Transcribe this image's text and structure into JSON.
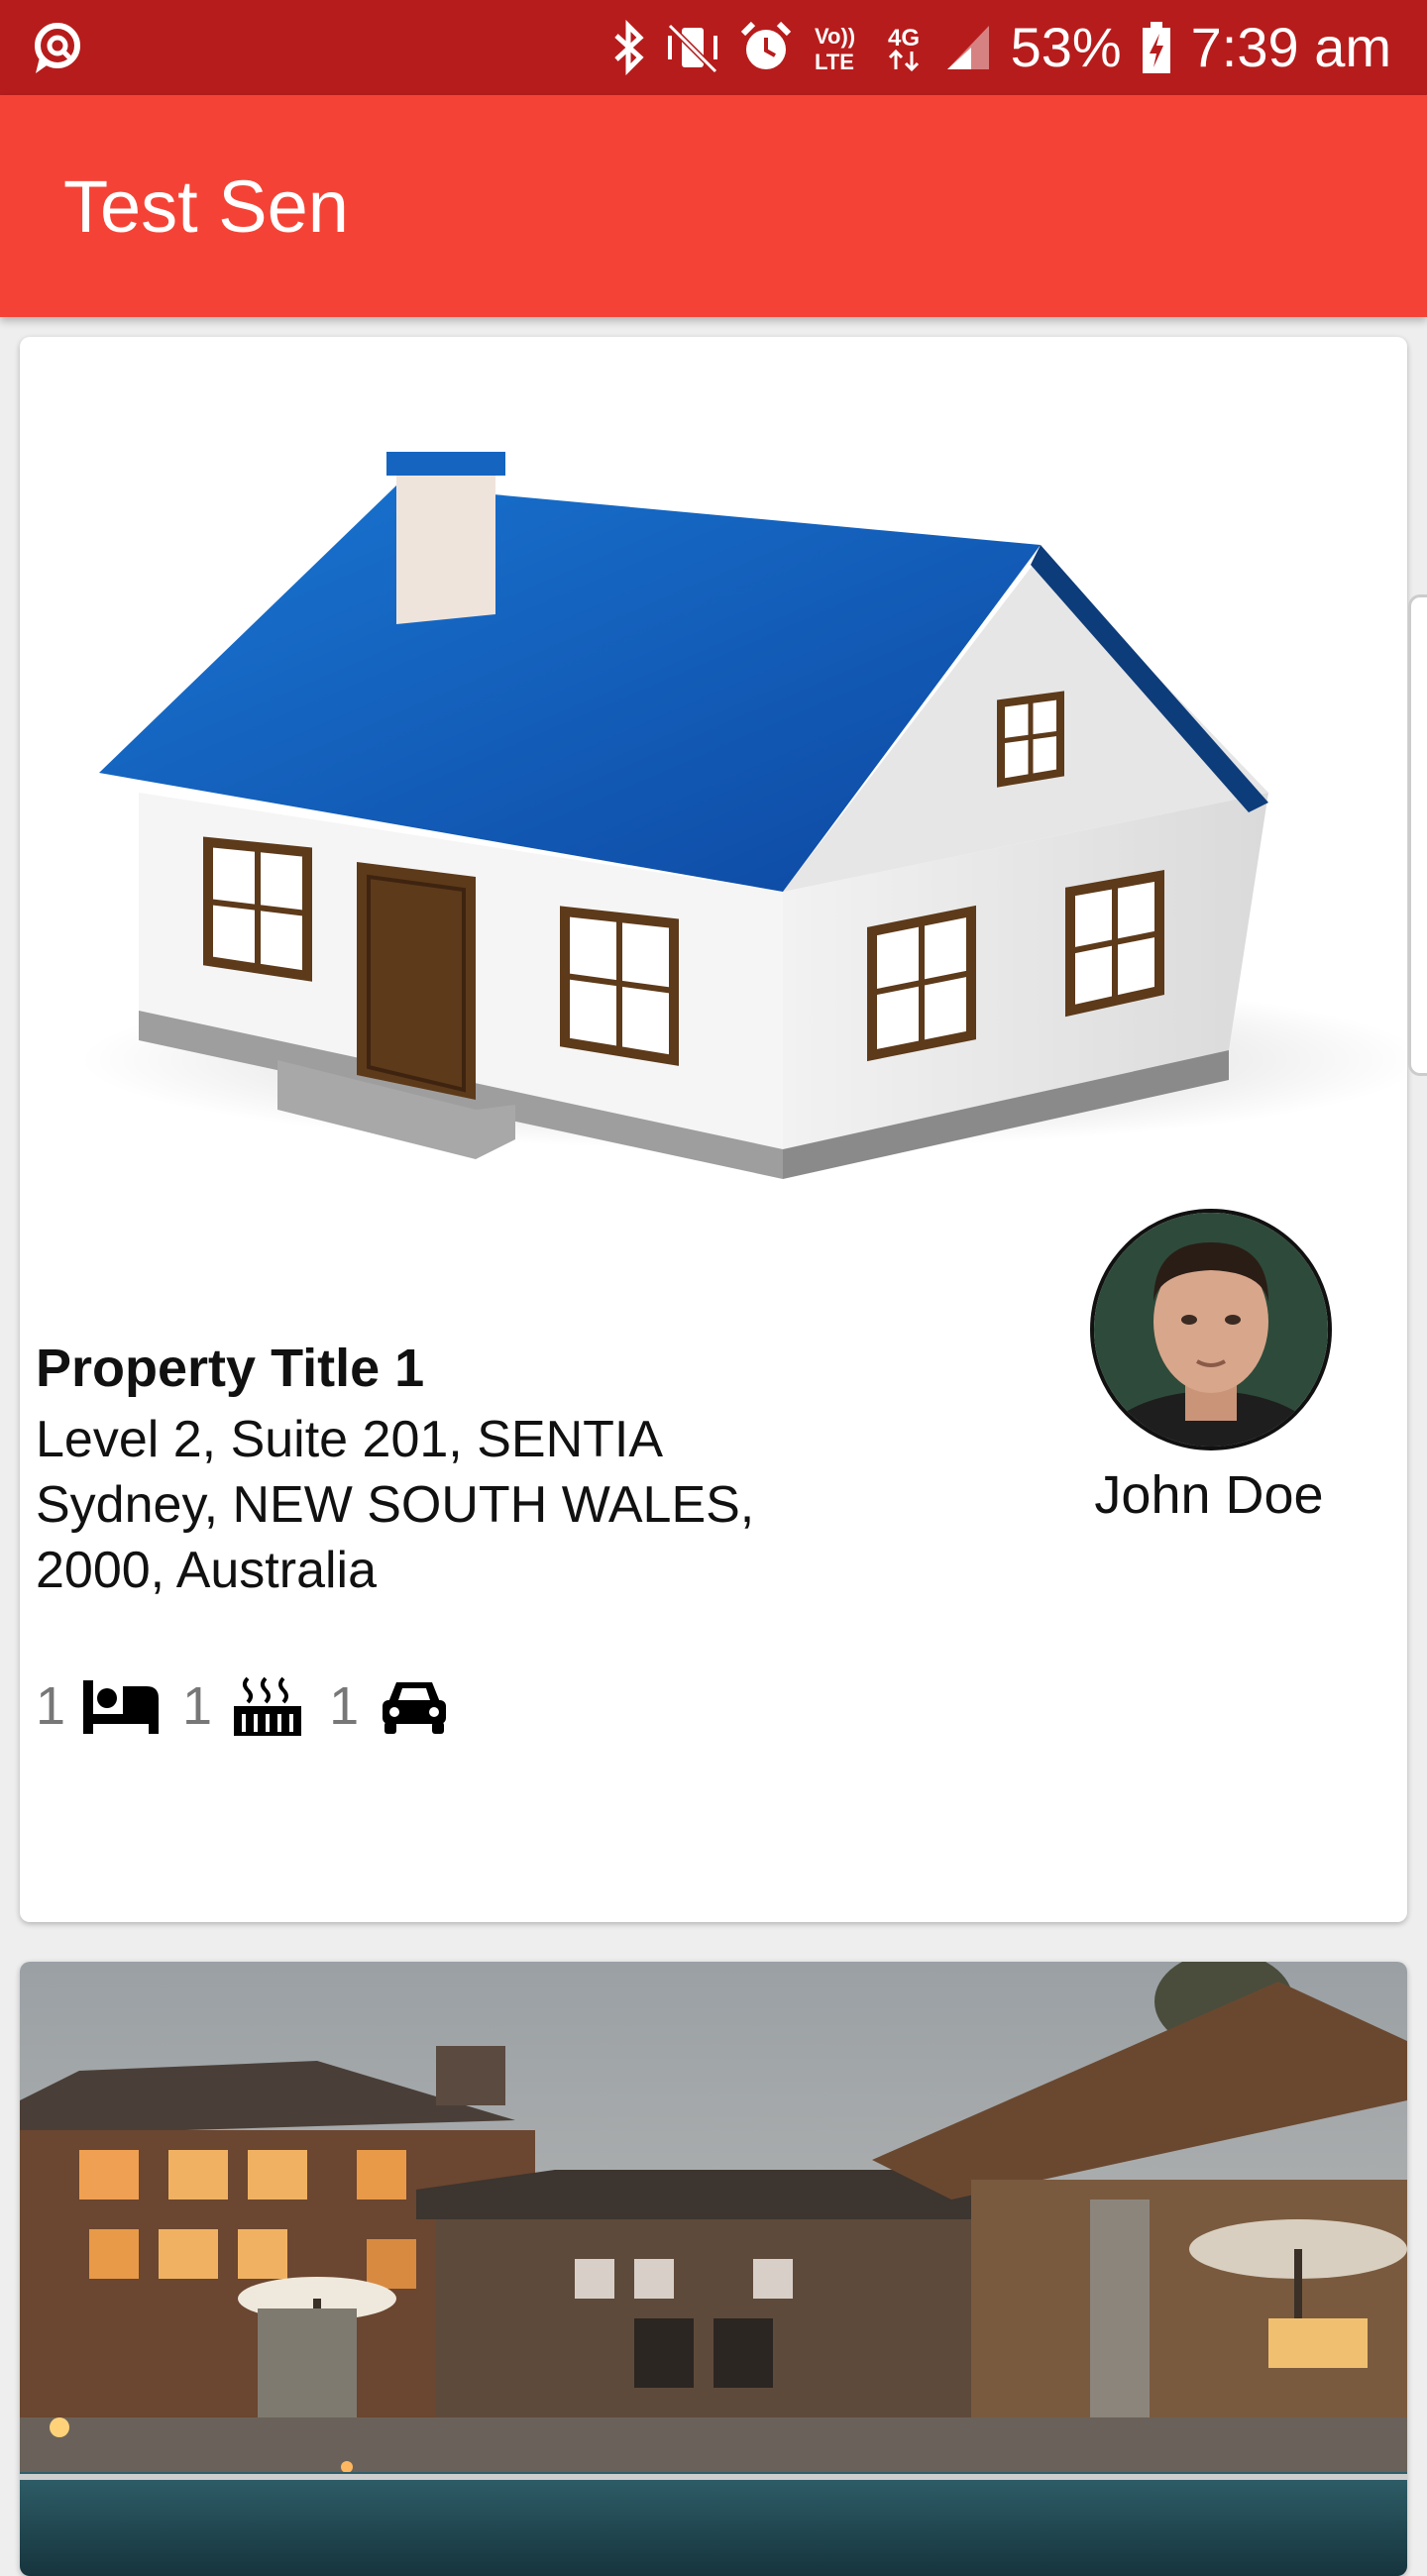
{
  "status_bar": {
    "battery_percent": "53%",
    "time": "7:39 am",
    "icons": [
      "chat-search-icon",
      "bluetooth-icon",
      "vibrate-icon",
      "alarm-icon",
      "volte-icon",
      "4g-icon",
      "signal-icon",
      "battery-charging-icon"
    ],
    "volte_label": "Vo)) LTE",
    "network_label": "4G"
  },
  "app_bar": {
    "title": "Test Sen"
  },
  "listings": [
    {
      "title": "Property Title 1",
      "address_line1": "Level 2, Suite 201, SENTIA",
      "address_line2": "Sydney, NEW SOUTH WALES,",
      "address_line3": "2000, Australia",
      "bedrooms": "1",
      "bathrooms": "1",
      "parking": "1",
      "agent_name": "John Doe"
    }
  ],
  "colors": {
    "status_bar": "#b71c1c",
    "app_bar": "#f44336",
    "roof": "#1565c0"
  }
}
